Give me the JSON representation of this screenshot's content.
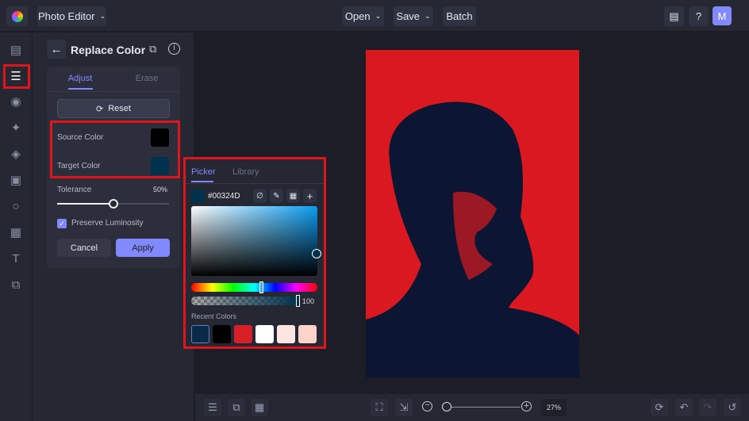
{
  "topbar": {
    "app_title": "Photo Editor",
    "open": "Open",
    "save": "Save",
    "batch": "Batch",
    "user_initial": "M"
  },
  "panel": {
    "title": "Replace Color",
    "tabs": [
      "Adjust",
      "Erase"
    ],
    "reset": "Reset",
    "source_label": "Source Color",
    "target_label": "Target Color",
    "tolerance_label": "Tolerance",
    "tolerance_value": "50%",
    "tolerance_fraction": 0.5,
    "preserve_label": "Preserve Luminosity",
    "preserve_checked": true,
    "cancel": "Cancel",
    "apply": "Apply"
  },
  "picker": {
    "tabs": [
      "Picker",
      "Library"
    ],
    "hex": "#00324D",
    "opacity": "100",
    "recent_label": "Recent Colors",
    "recent": [
      "#0b2a48",
      "#000000",
      "#d61f26",
      "#ffffff",
      "#fde5e1",
      "#fcd3c9"
    ]
  },
  "bottom": {
    "zoom": "27%"
  },
  "colors": {
    "accent": "#8189fb",
    "highlight": "#e0141b",
    "image_red": "#d9191f",
    "image_navy": "#0c1633"
  }
}
